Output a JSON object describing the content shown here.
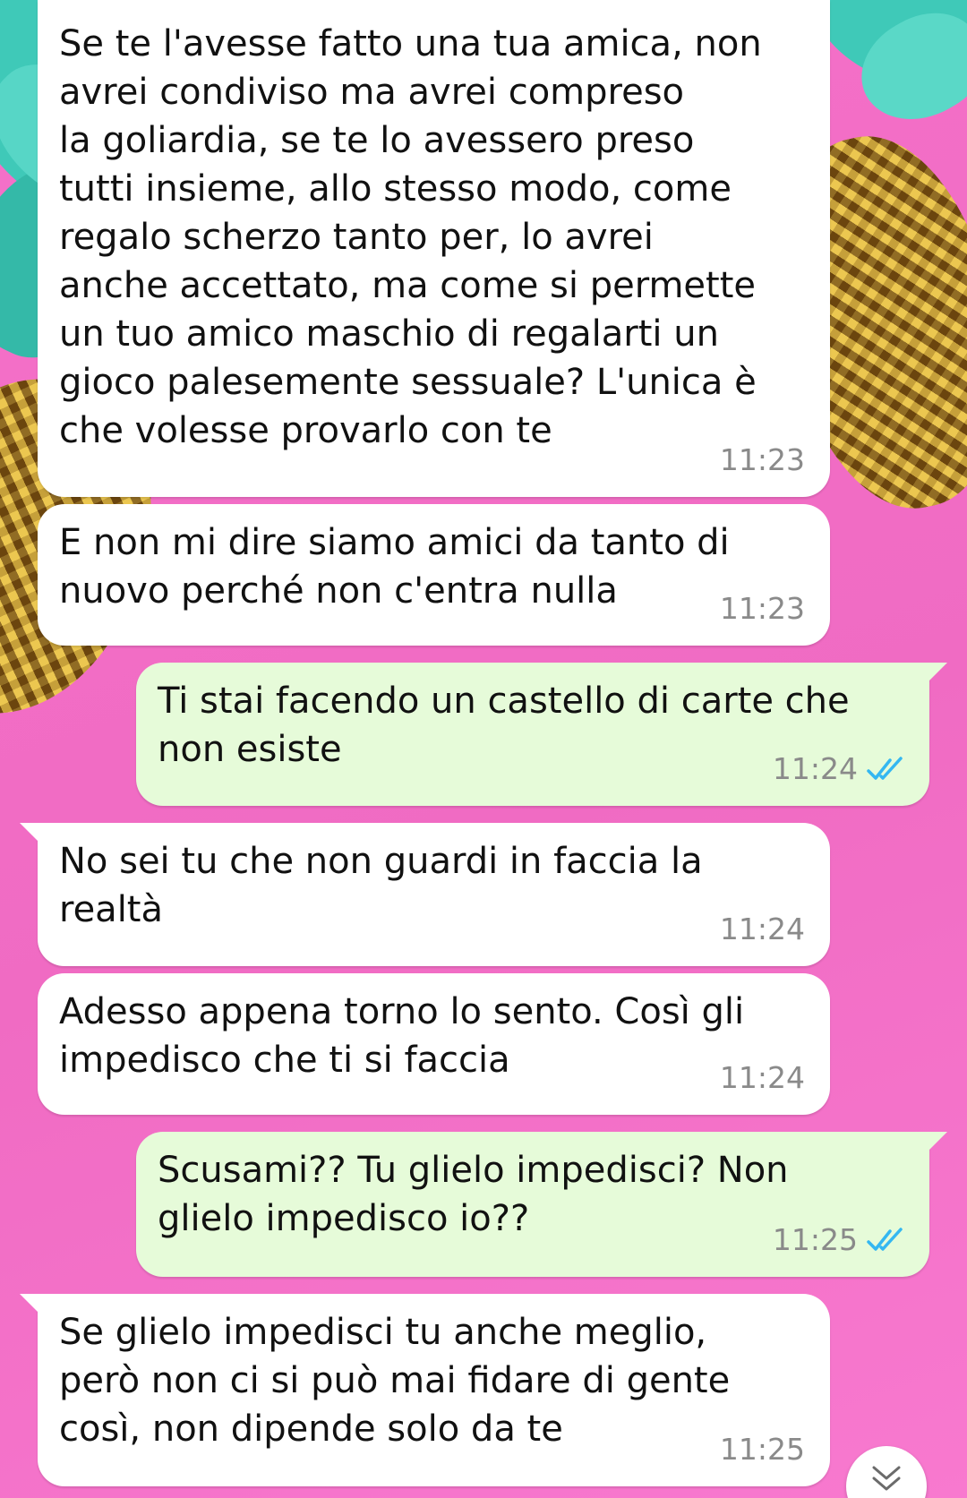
{
  "messages": [
    {
      "direction": "incoming",
      "text": "Se te l'avesse fatto una tua amica, non\navrei condiviso ma avrei compreso\nla goliardia, se te lo avessero preso\ntutti insieme, allo stesso modo, come\nregalo scherzo tanto per, lo avrei\nanche accettato, ma come si permette\nun tuo amico maschio di regalarti un\ngioco palesemente sessuale? L'unica è\nche volesse provarlo con te",
      "time": "11:23"
    },
    {
      "direction": "incoming",
      "text": "E non mi dire siamo amici da tanto di\nnuovo perché non c'entra nulla",
      "time": "11:23"
    },
    {
      "direction": "outgoing",
      "text": "Ti stai facendo un castello di carte che\nnon esiste",
      "time": "11:24",
      "status": "read"
    },
    {
      "direction": "incoming",
      "text": "No sei tu che non guardi in faccia la\nrealtà",
      "time": "11:24"
    },
    {
      "direction": "incoming",
      "text": "Adesso appena torno lo sento. Così gli\nimpedisco che ti si faccia",
      "time": "11:24"
    },
    {
      "direction": "outgoing",
      "text": "Scusami?? Tu glielo impedisci? Non\nglielo impedisco io??",
      "time": "11:25",
      "status": "read"
    },
    {
      "direction": "incoming",
      "text": "Se glielo impedisci tu anche meglio,\nperò non ci si può mai fidare di gente\ncosì, non dipende solo da te",
      "time": "11:25"
    }
  ],
  "icons": {
    "read_receipt": "double-check-icon",
    "scroll_down": "chevron-double-down-icon"
  },
  "colors": {
    "incoming_bubble": "#ffffff",
    "outgoing_bubble": "#e6fbd9",
    "read_ticks": "#34b7f1",
    "wallpaper": "#f36fc6"
  }
}
